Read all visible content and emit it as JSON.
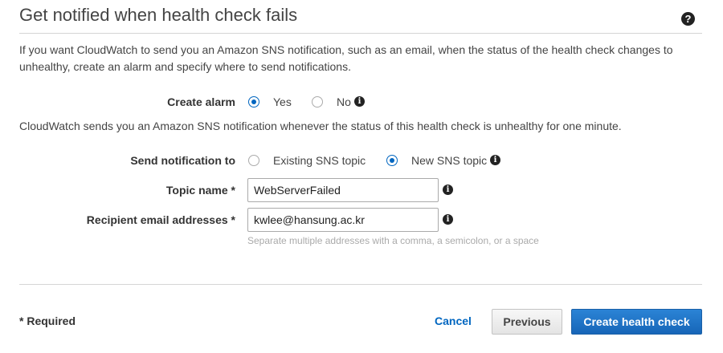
{
  "header": {
    "title": "Get notified when health check fails",
    "help_icon": "?"
  },
  "description": "If you want CloudWatch to send you an Amazon SNS notification, such as an email, when the status of the health check changes to unhealthy, create an alarm and specify where to send notifications.",
  "create_alarm": {
    "label": "Create alarm",
    "options": [
      {
        "label": "Yes",
        "selected": true
      },
      {
        "label": "No",
        "selected": false
      }
    ]
  },
  "alarm_note": "CloudWatch sends you an Amazon SNS notification whenever the status of this health check is unhealthy for one minute.",
  "send_notification": {
    "label": "Send notification to",
    "options": [
      {
        "label": "Existing SNS topic",
        "selected": false
      },
      {
        "label": "New SNS topic",
        "selected": true
      }
    ]
  },
  "topic_name": {
    "label": "Topic name *",
    "value": "WebServerFailed"
  },
  "recipient_emails": {
    "label": "Recipient email addresses *",
    "value": "kwlee@hansung.ac.kr",
    "hint": "Separate multiple addresses with a comma, a semicolon, or a space"
  },
  "footer": {
    "required_note": "* Required",
    "cancel_label": "Cancel",
    "previous_label": "Previous",
    "create_label": "Create health check"
  },
  "colors": {
    "accent": "#0066c0",
    "primary_button": "#1f74c7"
  }
}
